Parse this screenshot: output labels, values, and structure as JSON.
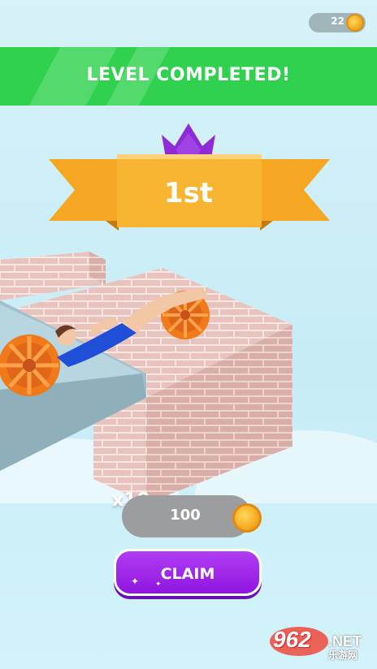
{
  "hud": {
    "coins": "22",
    "coin_icon": "coin-icon"
  },
  "banner": {
    "title": "LEVEL COMPLETED!",
    "color": "#2fd14e"
  },
  "result": {
    "rank": "1st",
    "crown_icon": "crown-icon",
    "ribbon_color": "#f5a623",
    "crown_color": "#8e2bd6"
  },
  "reward": {
    "multiplier": "x10",
    "amount": "100",
    "coin_icon": "coin-icon"
  },
  "claim": {
    "label": "CLAIM",
    "color": "#9b21e8"
  },
  "watermark": {
    "number": "962",
    "domain": ".NET",
    "site_name": "乐游网"
  }
}
